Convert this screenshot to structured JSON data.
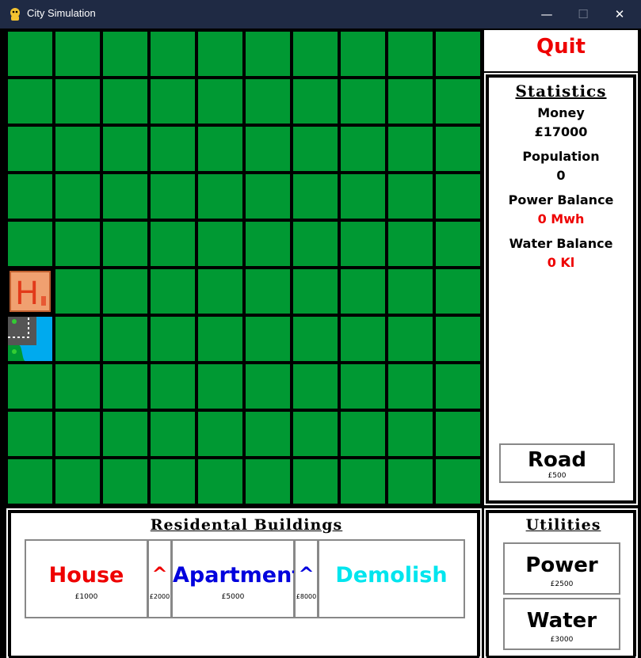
{
  "window": {
    "title": "City Simulation",
    "minimize": "—",
    "maximize": "☐",
    "close": "✕"
  },
  "quit": {
    "label": "Quit",
    "color": "#ee0000"
  },
  "statistics": {
    "title": "Statistics",
    "money_label": "Money",
    "money_value": "£17000",
    "population_label": "Population",
    "population_value": "0",
    "power_label": "Power Balance",
    "power_value": "0 Mwh",
    "water_label": "Water Balance",
    "water_value": "0 Kl"
  },
  "road": {
    "label": "Road",
    "price": "£500"
  },
  "residential": {
    "title": "Residental Buildings",
    "house_label": "House",
    "house_price": "£1000",
    "house_upgrade": "^",
    "house_upgrade_price": "£2000",
    "apartment_label": "Apartment",
    "apartment_price": "£5000",
    "apartment_upgrade": "^",
    "apartment_upgrade_price": "£8000",
    "demolish_label": "Demolish"
  },
  "utilities": {
    "title": "Utilities",
    "power_label": "Power",
    "power_price": "£2500",
    "water_label": "Water",
    "water_price": "£3000"
  },
  "map": {
    "rows": 10,
    "cols": 10,
    "house_tile_letter": "H",
    "grass_color": "#009933",
    "house_color": "#f0a070",
    "water_color": "#00aaee"
  }
}
